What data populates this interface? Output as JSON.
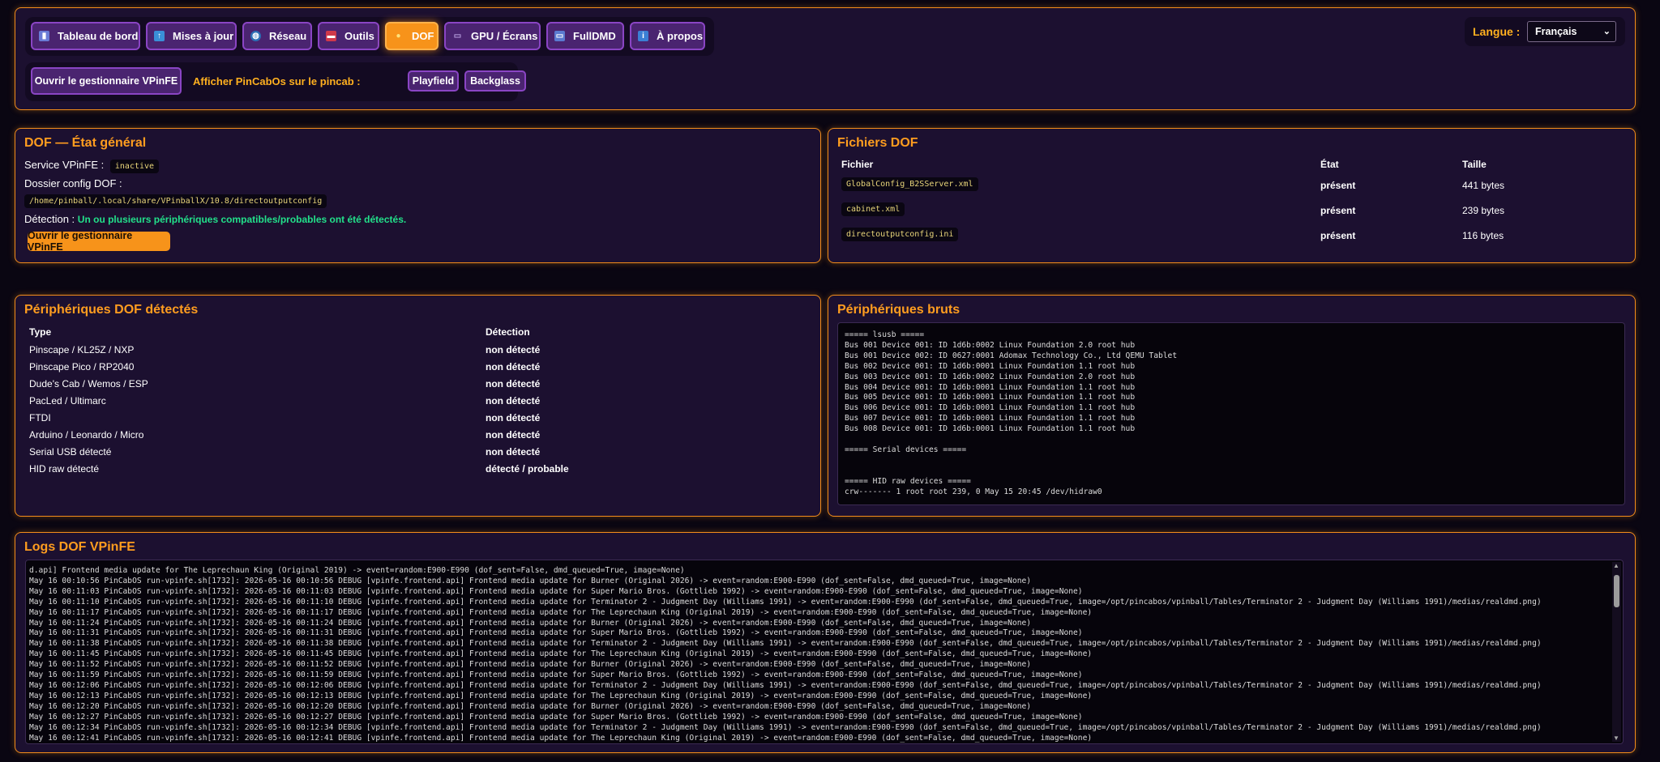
{
  "nav": {
    "tabs": [
      {
        "label": "Tableau de bord",
        "icon": "bar-chart-icon",
        "active": false
      },
      {
        "label": "Mises à jour",
        "icon": "up-arrow-icon",
        "active": false
      },
      {
        "label": "Réseau",
        "icon": "globe-icon",
        "active": false
      },
      {
        "label": "Outils",
        "icon": "toolbox-icon",
        "active": false
      },
      {
        "label": "DOF",
        "icon": "lightbulb-icon",
        "active": true
      },
      {
        "label": "GPU / Écrans",
        "icon": "gpu-icon",
        "active": false
      },
      {
        "label": "FullDMD",
        "icon": "monitor-icon",
        "active": false
      },
      {
        "label": "À propos",
        "icon": "info-icon",
        "active": false
      }
    ],
    "open_vpinfe_label": "Ouvrir le gestionnaire VPinFE",
    "show_label": "Afficher PinCabOs sur le pincab :",
    "playfield_label": "Playfield",
    "backglass_label": "Backglass",
    "language_label": "Langue :",
    "language_value": "Français"
  },
  "status": {
    "title": "DOF — État général",
    "service_label": "Service VPinFE :",
    "service_value": "inactive",
    "config_label": "Dossier config DOF :",
    "config_value": "/home/pinball/.local/share/VPinballX/10.8/directoutputconfig",
    "detection_label": "Détection :",
    "detection_value": "Un ou plusieurs périphériques compatibles/probables ont été détectés.",
    "open_button": "Ouvrir le gestionnaire VPinFE"
  },
  "files": {
    "title": "Fichiers DOF",
    "headers": {
      "file": "Fichier",
      "state": "État",
      "size": "Taille"
    },
    "rows": [
      {
        "name": "GlobalConfig_B2SServer.xml",
        "state": "présent",
        "size": "441 bytes"
      },
      {
        "name": "cabinet.xml",
        "state": "présent",
        "size": "239 bytes"
      },
      {
        "name": "directoutputconfig.ini",
        "state": "présent",
        "size": "116 bytes"
      }
    ]
  },
  "devices": {
    "title": "Périphériques DOF détectés",
    "headers": {
      "type": "Type",
      "detection": "Détection"
    },
    "rows": [
      {
        "type": "Pinscape / KL25Z / NXP",
        "detection": "non détecté",
        "ok": false
      },
      {
        "type": "Pinscape Pico / RP2040",
        "detection": "non détecté",
        "ok": false
      },
      {
        "type": "Dude's Cab / Wemos / ESP",
        "detection": "non détecté",
        "ok": false
      },
      {
        "type": "PacLed / Ultimarc",
        "detection": "non détecté",
        "ok": false
      },
      {
        "type": "FTDI",
        "detection": "non détecté",
        "ok": false
      },
      {
        "type": "Arduino / Leonardo / Micro",
        "detection": "non détecté",
        "ok": false
      },
      {
        "type": "Serial USB détecté",
        "detection": "non détecté",
        "ok": false
      },
      {
        "type": "HID raw détecté",
        "detection": "détecté / probable",
        "ok": true
      }
    ]
  },
  "raw": {
    "title": "Périphériques bruts",
    "text": "===== lsusb =====\nBus 001 Device 001: ID 1d6b:0002 Linux Foundation 2.0 root hub\nBus 001 Device 002: ID 0627:0001 Adomax Technology Co., Ltd QEMU Tablet\nBus 002 Device 001: ID 1d6b:0001 Linux Foundation 1.1 root hub\nBus 003 Device 001: ID 1d6b:0002 Linux Foundation 2.0 root hub\nBus 004 Device 001: ID 1d6b:0001 Linux Foundation 1.1 root hub\nBus 005 Device 001: ID 1d6b:0001 Linux Foundation 1.1 root hub\nBus 006 Device 001: ID 1d6b:0001 Linux Foundation 1.1 root hub\nBus 007 Device 001: ID 1d6b:0001 Linux Foundation 1.1 root hub\nBus 008 Device 001: ID 1d6b:0001 Linux Foundation 1.1 root hub\n\n===== Serial devices =====\n\n\n===== HID raw devices =====\ncrw------- 1 root root 239, 0 May 15 20:45 /dev/hidraw0"
  },
  "logs": {
    "title": "Logs DOF VPinFE",
    "text": "d.api] Frontend media update for The Leprechaun King (Original 2019) -> event=random:E900-E990 (dof_sent=False, dmd_queued=True, image=None)\nMay 16 00:10:56 PinCabOS run-vpinfe.sh[1732]: 2026-05-16 00:10:56 DEBUG [vpinfe.frontend.api] Frontend media update for Burner (Original 2026) -> event=random:E900-E990 (dof_sent=False, dmd_queued=True, image=None)\nMay 16 00:11:03 PinCabOS run-vpinfe.sh[1732]: 2026-05-16 00:11:03 DEBUG [vpinfe.frontend.api] Frontend media update for Super Mario Bros. (Gottlieb 1992) -> event=random:E900-E990 (dof_sent=False, dmd_queued=True, image=None)\nMay 16 00:11:10 PinCabOS run-vpinfe.sh[1732]: 2026-05-16 00:11:10 DEBUG [vpinfe.frontend.api] Frontend media update for Terminator 2 - Judgment Day (Williams 1991) -> event=random:E900-E990 (dof_sent=False, dmd_queued=True, image=/opt/pincabos/vpinball/Tables/Terminator 2 - Judgment Day (Williams 1991)/medias/realdmd.png)\nMay 16 00:11:17 PinCabOS run-vpinfe.sh[1732]: 2026-05-16 00:11:17 DEBUG [vpinfe.frontend.api] Frontend media update for The Leprechaun King (Original 2019) -> event=random:E900-E990 (dof_sent=False, dmd_queued=True, image=None)\nMay 16 00:11:24 PinCabOS run-vpinfe.sh[1732]: 2026-05-16 00:11:24 DEBUG [vpinfe.frontend.api] Frontend media update for Burner (Original 2026) -> event=random:E900-E990 (dof_sent=False, dmd_queued=True, image=None)\nMay 16 00:11:31 PinCabOS run-vpinfe.sh[1732]: 2026-05-16 00:11:31 DEBUG [vpinfe.frontend.api] Frontend media update for Super Mario Bros. (Gottlieb 1992) -> event=random:E900-E990 (dof_sent=False, dmd_queued=True, image=None)\nMay 16 00:11:38 PinCabOS run-vpinfe.sh[1732]: 2026-05-16 00:11:38 DEBUG [vpinfe.frontend.api] Frontend media update for Terminator 2 - Judgment Day (Williams 1991) -> event=random:E900-E990 (dof_sent=False, dmd_queued=True, image=/opt/pincabos/vpinball/Tables/Terminator 2 - Judgment Day (Williams 1991)/medias/realdmd.png)\nMay 16 00:11:45 PinCabOS run-vpinfe.sh[1732]: 2026-05-16 00:11:45 DEBUG [vpinfe.frontend.api] Frontend media update for The Leprechaun King (Original 2019) -> event=random:E900-E990 (dof_sent=False, dmd_queued=True, image=None)\nMay 16 00:11:52 PinCabOS run-vpinfe.sh[1732]: 2026-05-16 00:11:52 DEBUG [vpinfe.frontend.api] Frontend media update for Burner (Original 2026) -> event=random:E900-E990 (dof_sent=False, dmd_queued=True, image=None)\nMay 16 00:11:59 PinCabOS run-vpinfe.sh[1732]: 2026-05-16 00:11:59 DEBUG [vpinfe.frontend.api] Frontend media update for Super Mario Bros. (Gottlieb 1992) -> event=random:E900-E990 (dof_sent=False, dmd_queued=True, image=None)\nMay 16 00:12:06 PinCabOS run-vpinfe.sh[1732]: 2026-05-16 00:12:06 DEBUG [vpinfe.frontend.api] Frontend media update for Terminator 2 - Judgment Day (Williams 1991) -> event=random:E900-E990 (dof_sent=False, dmd_queued=True, image=/opt/pincabos/vpinball/Tables/Terminator 2 - Judgment Day (Williams 1991)/medias/realdmd.png)\nMay 16 00:12:13 PinCabOS run-vpinfe.sh[1732]: 2026-05-16 00:12:13 DEBUG [vpinfe.frontend.api] Frontend media update for The Leprechaun King (Original 2019) -> event=random:E900-E990 (dof_sent=False, dmd_queued=True, image=None)\nMay 16 00:12:20 PinCabOS run-vpinfe.sh[1732]: 2026-05-16 00:12:20 DEBUG [vpinfe.frontend.api] Frontend media update for Burner (Original 2026) -> event=random:E900-E990 (dof_sent=False, dmd_queued=True, image=None)\nMay 16 00:12:27 PinCabOS run-vpinfe.sh[1732]: 2026-05-16 00:12:27 DEBUG [vpinfe.frontend.api] Frontend media update for Super Mario Bros. (Gottlieb 1992) -> event=random:E900-E990 (dof_sent=False, dmd_queued=True, image=None)\nMay 16 00:12:34 PinCabOS run-vpinfe.sh[1732]: 2026-05-16 00:12:34 DEBUG [vpinfe.frontend.api] Frontend media update for Terminator 2 - Judgment Day (Williams 1991) -> event=random:E900-E990 (dof_sent=False, dmd_queued=True, image=/opt/pincabos/vpinball/Tables/Terminator 2 - Judgment Day (Williams 1991)/medias/realdmd.png)\nMay 16 00:12:41 PinCabOS run-vpinfe.sh[1732]: 2026-05-16 00:12:41 DEBUG [vpinfe.frontend.api] Frontend media update for The Leprechaun King (Original 2019) -> event=random:E900-E990 (dof_sent=False, dmd_queued=True, image=None)"
  },
  "colors": {
    "accent": "#f7931a",
    "panel_border": "#f28c1a",
    "tab_bg": "#4a2470",
    "ok": "#22e08a",
    "ko": "#ff4f5e"
  }
}
